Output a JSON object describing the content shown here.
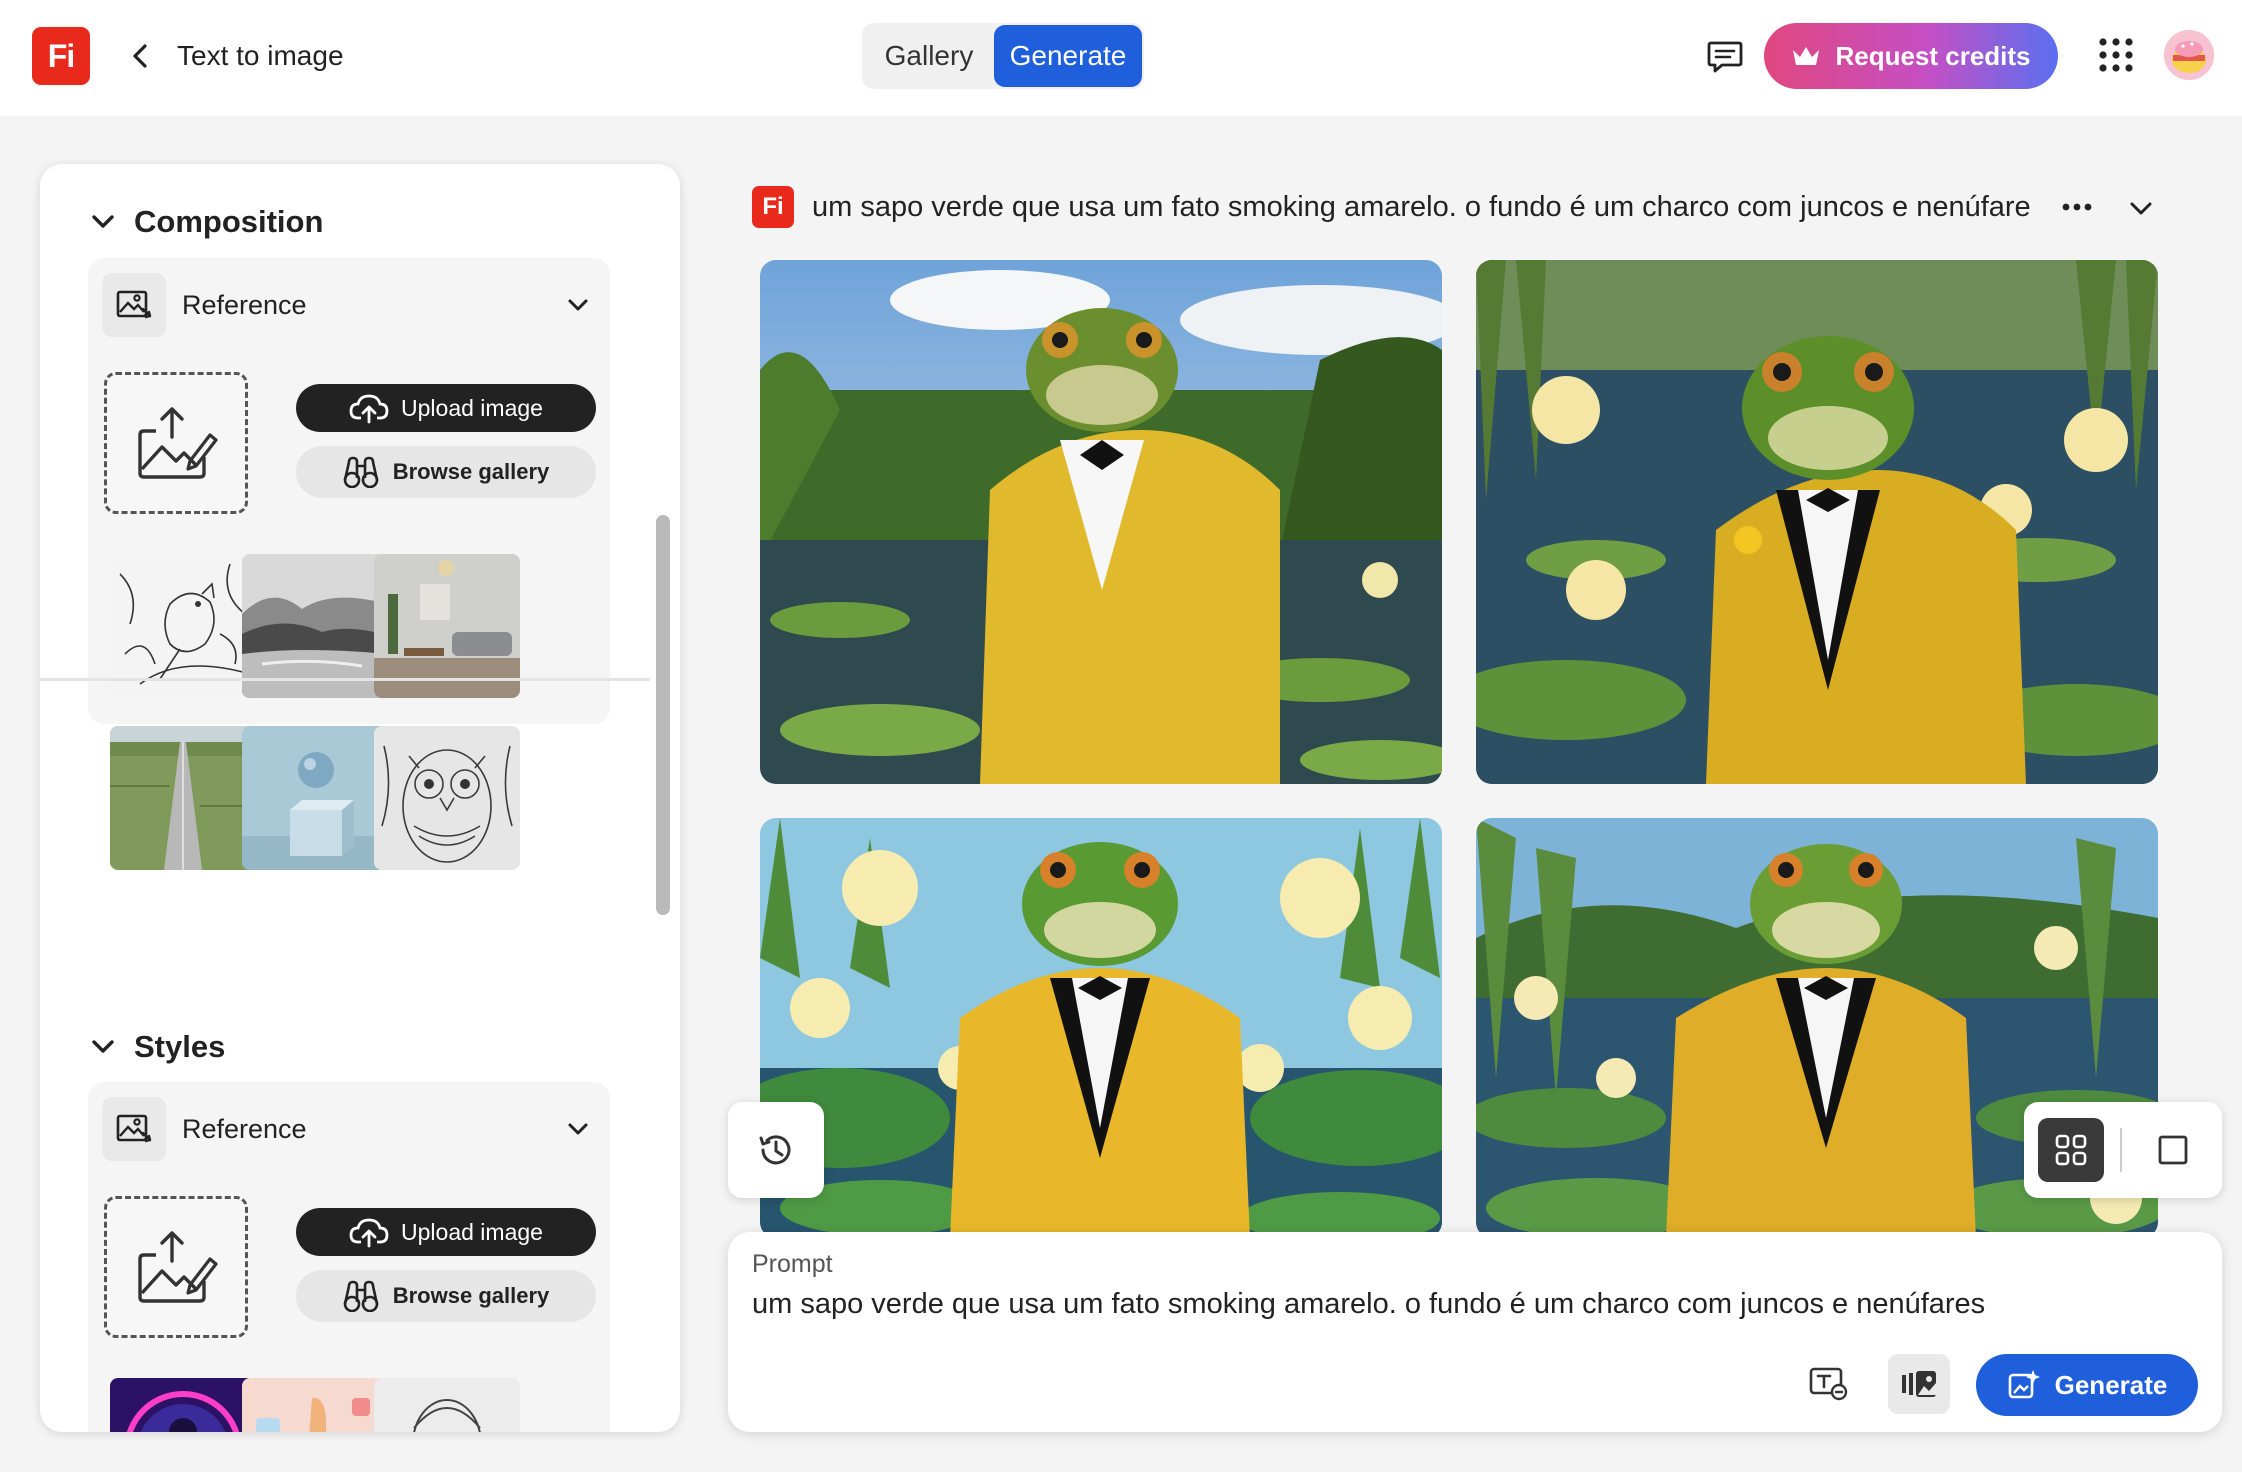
{
  "app": {
    "logo_text": "Fi",
    "page_title": "Text to image"
  },
  "header": {
    "tabs": [
      {
        "label": "Gallery",
        "active": false
      },
      {
        "label": "Generate",
        "active": true
      }
    ],
    "request_credits_label": "Request credits"
  },
  "sidebar": {
    "composition": {
      "title": "Composition",
      "reference_label": "Reference",
      "upload_label": "Upload image",
      "browse_label": "Browse gallery",
      "thumbnails": [
        "line-art-bird",
        "misty-mountain-lake",
        "living-room-interior",
        "aerial-road-fields",
        "sphere-on-cube",
        "line-art-owl"
      ]
    },
    "styles": {
      "title": "Styles",
      "reference_label": "Reference",
      "upload_label": "Upload image",
      "browse_label": "Browse gallery",
      "thumbnails": [
        "neon-portrait",
        "pastel-hand",
        "sketch-portrait"
      ]
    }
  },
  "main": {
    "logo_text": "Fi",
    "prompt_title": "um sapo verde que usa um fato smoking amarelo. o fundo é um charco com juncos e nenúfare",
    "images": [
      {
        "subject": "frog in yellow tuxedo, photoreal pond with reeds"
      },
      {
        "subject": "frog in yellow tuxedo with rose, lotus pond"
      },
      {
        "subject": "frog in yellow tuxedo, illustrated lotus flowers"
      },
      {
        "subject": "frog in yellow tuxedo sitting, illustrated pond"
      }
    ]
  },
  "prompt_panel": {
    "label": "Prompt",
    "text": "um sapo verde que usa um fato smoking amarelo. o fundo é um charco com juncos e nenúfares",
    "generate_label": "Generate"
  },
  "colors": {
    "accent": "#1f5fdb",
    "brand": "#e8291c",
    "credits_gradient": [
      "#e0477f",
      "#c64fc4",
      "#5a6ff0"
    ]
  }
}
